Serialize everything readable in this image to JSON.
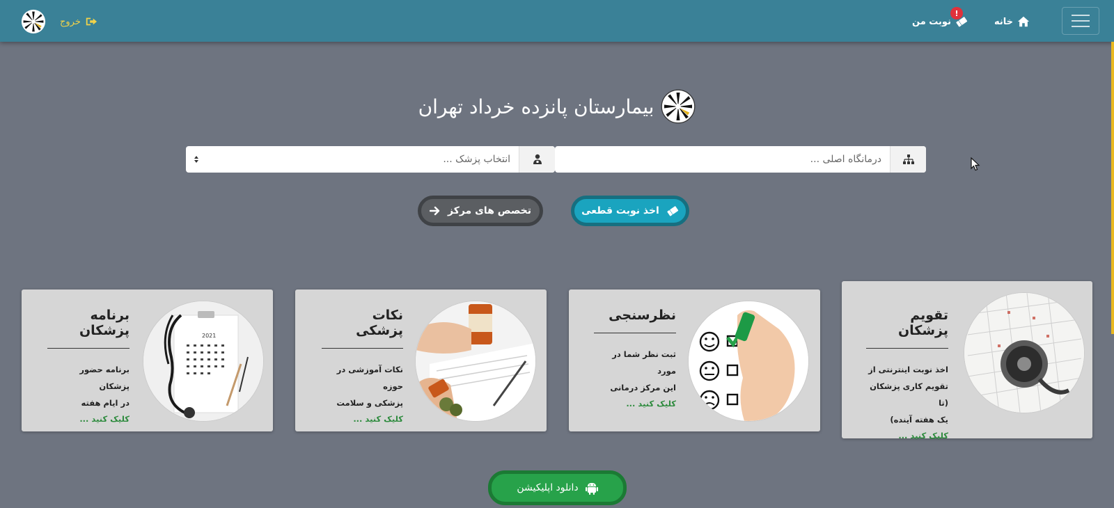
{
  "nav": {
    "home_label": "خانه",
    "myturn_label": "نوبت من",
    "myturn_badge": "!",
    "exit_label": "خروج"
  },
  "header": {
    "title": "بیمارستان پانزده خرداد تهران"
  },
  "selectors": {
    "clinic_placeholder": "درمانگاه اصلی ...",
    "doctor_placeholder": "انتخاب پزشک ..."
  },
  "buttons": {
    "final_appointment": "اخذ نوبت قطعی",
    "center_specialties": "تخصص های مرکز",
    "download_app": "دانلود اپلیکیشن"
  },
  "cards": [
    {
      "title": "تقویم پزشکان",
      "desc_lines": [
        "اخذ نوبت اینترنتی از",
        "تقویم کاری پزشکان (تا",
        "یک هفته آینده)"
      ],
      "link": "کلیک کنید ..."
    },
    {
      "title": "نظرسنجی",
      "desc_lines": [
        "ثبت نظر شما در مورد",
        "این مرکز درمانی"
      ],
      "link": "کلیک کنید ..."
    },
    {
      "title": "نکات پزشکی",
      "desc_lines": [
        "نکات آموزشی در حوزه",
        "پزشکی و سلامت"
      ],
      "link": "کلیک کنید ..."
    },
    {
      "title": "برنامه پزشکان",
      "desc_lines": [
        "برنامه حضور پزشکان",
        "در ایام هفته"
      ],
      "link": "کلیک کنید ..."
    }
  ],
  "colors": {
    "navbar": "#3a8197",
    "background": "#6e7480",
    "final_button": "#1aa4bf",
    "app_button": "#27a24a",
    "link_green": "#2e8b3e",
    "exit_yellow": "#f1d24a"
  },
  "icons": [
    "home-icon",
    "ticket-icon",
    "exit-icon",
    "hospital-logo",
    "sitemap-icon",
    "doctor-icon",
    "ticket-icon",
    "arrow-right-icon",
    "android-icon"
  ]
}
